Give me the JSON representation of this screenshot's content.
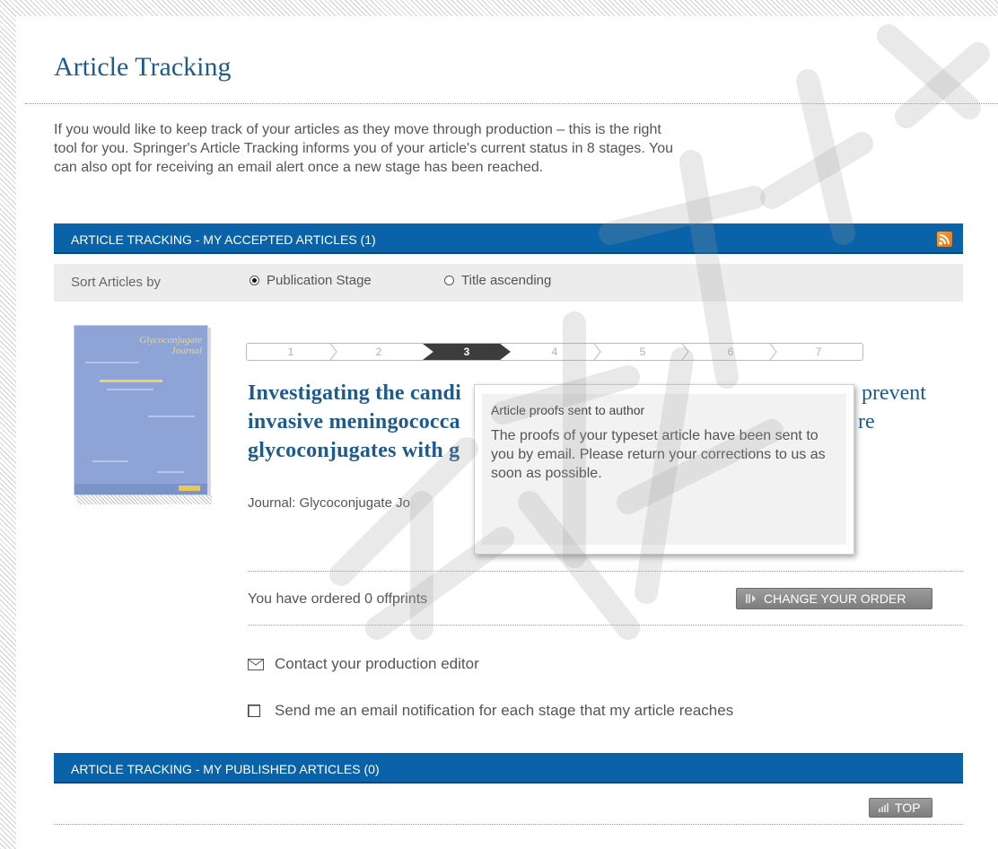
{
  "page": {
    "title": "Article Tracking",
    "intro": [
      "If you would like to keep track of your articles as they move through production – this is the right",
      "tool for you. Springer's Article Tracking informs you of your article's current status in 8 stages. You",
      "can also opt for receiving an email alert once a new stage has been reached."
    ]
  },
  "accepted": {
    "header": "ARTICLE TRACKING - MY ACCEPTED ARTICLES (1)",
    "rss_icon": "rss-feed-icon",
    "sort_label": "Sort Articles by",
    "sort_options": [
      {
        "label": "Publication Stage",
        "selected": true
      },
      {
        "label": "Title ascending",
        "selected": false
      }
    ]
  },
  "article": {
    "cover_title": "Glycoconjugate Journal",
    "stages": [
      "1",
      "2",
      "3",
      "4",
      "5",
      "6",
      "7"
    ],
    "current_stage": 3,
    "title_lines": [
      "Investigating the candi",
      "invasive meningococca",
      "glycoconjugates with g"
    ],
    "title_tail_right": [
      "prevent",
      "re"
    ],
    "journal": "Journal: Glycoconjugate Jo",
    "offprints_text": "You have ordered 0 offprints",
    "change_order_label": "CHANGE YOUR ORDER",
    "contact_label": "Contact your production editor",
    "notify_label": "Send me an email notification for each stage that my article reaches",
    "notify_checked": false
  },
  "tooltip": {
    "heading": "Article proofs sent to author",
    "body": "The proofs of your typeset article have been sent to you by email. Please return your corrections to us as soon as possible."
  },
  "published": {
    "header": "ARTICLE TRACKING - MY PUBLISHED ARTICLES (0)",
    "top_label": "TOP"
  },
  "colors": {
    "accent": "#1f5a8c",
    "bar": "#0a62a8",
    "active_stage": "#3c3c3c",
    "rss": "#f18a2c"
  }
}
